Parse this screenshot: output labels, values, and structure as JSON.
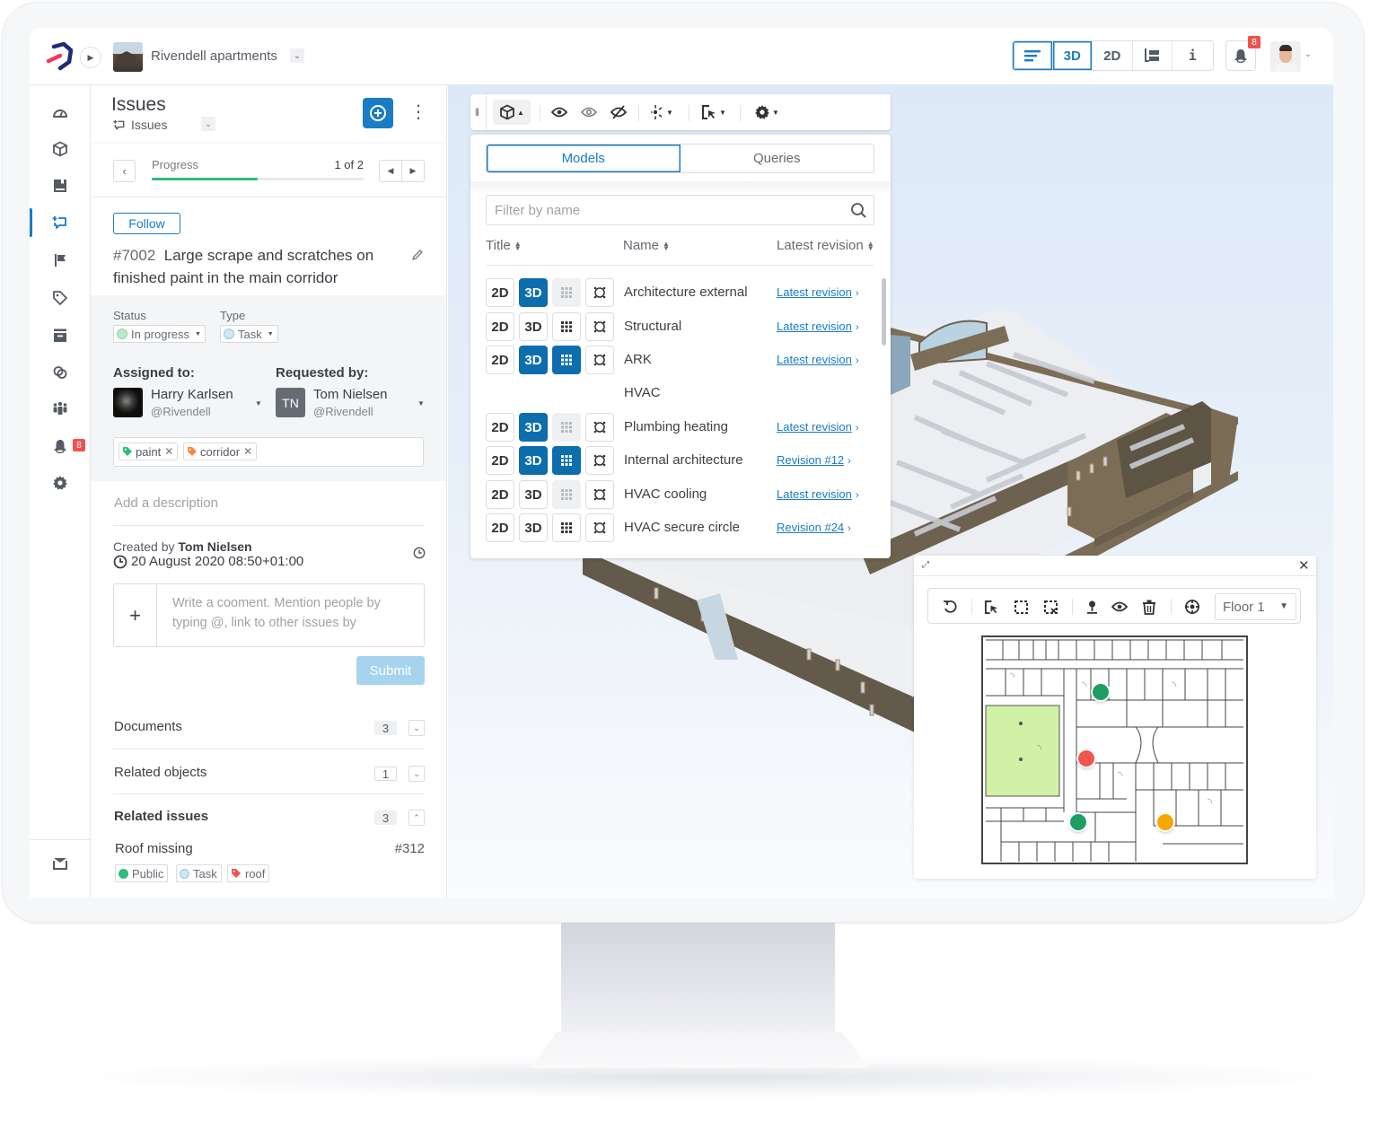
{
  "app": {
    "project_name": "Rivendell apartments",
    "view_modes": [
      {
        "id": "list",
        "label": "",
        "icon": "list-icon",
        "active": false
      },
      {
        "id": "3d",
        "label": "3D",
        "active": true
      },
      {
        "id": "2d",
        "label": "2D",
        "active": false
      },
      {
        "id": "split",
        "label": "",
        "icon": "split-view-icon",
        "active": false
      },
      {
        "id": "info",
        "label": "i",
        "active": false
      }
    ],
    "notifications_count": "8"
  },
  "sidebar": {
    "items": [
      {
        "name": "dashboard",
        "icon": "gauge-icon"
      },
      {
        "name": "models",
        "icon": "cube-icon"
      },
      {
        "name": "documents",
        "icon": "book-icon"
      },
      {
        "name": "issues",
        "icon": "issues-icon",
        "active": true
      },
      {
        "name": "flags",
        "icon": "flag-icon"
      },
      {
        "name": "tags",
        "icon": "tag-icon"
      },
      {
        "name": "archive",
        "icon": "archive-icon"
      },
      {
        "name": "links",
        "icon": "link-icon"
      },
      {
        "name": "team",
        "icon": "team-icon"
      },
      {
        "name": "notifications",
        "icon": "bell-icon",
        "badge": "8"
      },
      {
        "name": "settings",
        "icon": "gear-icon"
      },
      {
        "name": "inbox",
        "icon": "inbox-icon"
      }
    ]
  },
  "issue_panel": {
    "title": "Issues",
    "subtitle": "Issues",
    "progress": {
      "label": "Progress",
      "count_text": "1 of 2",
      "fraction": 0.5
    },
    "follow_label": "Follow",
    "issue": {
      "number": "#7002",
      "title": "Large scrape and scratches on finished paint in the main corridor"
    },
    "status": {
      "label": "Status",
      "value": "In progress",
      "color": "#bfe8cf"
    },
    "type": {
      "label": "Type",
      "value": "Task",
      "color": "#cfe6f3"
    },
    "assigned": {
      "label": "Assigned to:",
      "name": "Harry Karlsen",
      "handle": "@Rivendell"
    },
    "requested": {
      "label": "Requested by:",
      "name": "Tom Nielsen",
      "handle": "@Rivendell",
      "initials": "TN"
    },
    "tags": [
      {
        "label": "paint",
        "color": "#2ebd7a"
      },
      {
        "label": "corridor",
        "color": "#f58a3d"
      }
    ],
    "description_placeholder": "Add a description",
    "created_prefix": "Created by",
    "created_by": "Tom Nielsen",
    "created_date": "20 August 2020 08:50+01:00",
    "comment_placeholder": "Write a cooment. Mention people by typing @, link to other issues by",
    "submit_label": "Submit",
    "sections": [
      {
        "name": "Documents",
        "count": "3",
        "expanded": false
      },
      {
        "name": "Related objects",
        "count": "1",
        "expanded": false
      },
      {
        "name": "Related issues",
        "count": "3",
        "expanded": true
      }
    ],
    "related_issue": {
      "title": "Roof missing",
      "number": "#312",
      "tags": [
        {
          "label": "Public",
          "color": "#2ebd7a",
          "kind": "dot"
        },
        {
          "label": "Task",
          "color": "#cfe6f3",
          "kind": "dot"
        },
        {
          "label": "roof",
          "color": "#ef5350",
          "kind": "tag"
        }
      ]
    }
  },
  "viewer": {
    "models_panel": {
      "tabs": [
        {
          "label": "Models",
          "active": true
        },
        {
          "label": "Queries",
          "active": false
        }
      ],
      "filter_placeholder": "Filter by name",
      "columns": [
        "Title",
        "Name",
        "Latest revision"
      ],
      "rows": [
        {
          "name": "Architecture external",
          "d2": false,
          "d3": true,
          "grid": "disabled",
          "revision": "Latest revision"
        },
        {
          "name": "Structural",
          "d2": false,
          "d3": false,
          "grid": "off",
          "revision": "Latest revision"
        },
        {
          "name": "ARK",
          "d2": false,
          "d3": true,
          "grid": "on",
          "revision": "Latest revision"
        },
        {
          "name": "HVAC",
          "group": true
        },
        {
          "name": "Plumbing heating",
          "d2": false,
          "d3": true,
          "grid": "disabled",
          "revision": "Latest revision"
        },
        {
          "name": "Internal architecture",
          "d2": false,
          "d3": true,
          "grid": "on",
          "revision": "Revision #12"
        },
        {
          "name": "HVAC cooling",
          "d2": false,
          "d3": false,
          "grid": "disabled",
          "revision": "Latest revision"
        },
        {
          "name": "HVAC secure circle",
          "d2": false,
          "d3": false,
          "grid": "off",
          "revision": "Revision #24"
        }
      ],
      "btn_2d": "2D",
      "btn_3d": "3D"
    },
    "floor_plan": {
      "floor_selected": "Floor 1",
      "markers": [
        {
          "status": "green",
          "color": "#1e9e63"
        },
        {
          "status": "red",
          "color": "#f0564e"
        },
        {
          "status": "green",
          "color": "#1e9e63"
        },
        {
          "status": "yellow",
          "color": "#f5a800"
        }
      ]
    }
  }
}
